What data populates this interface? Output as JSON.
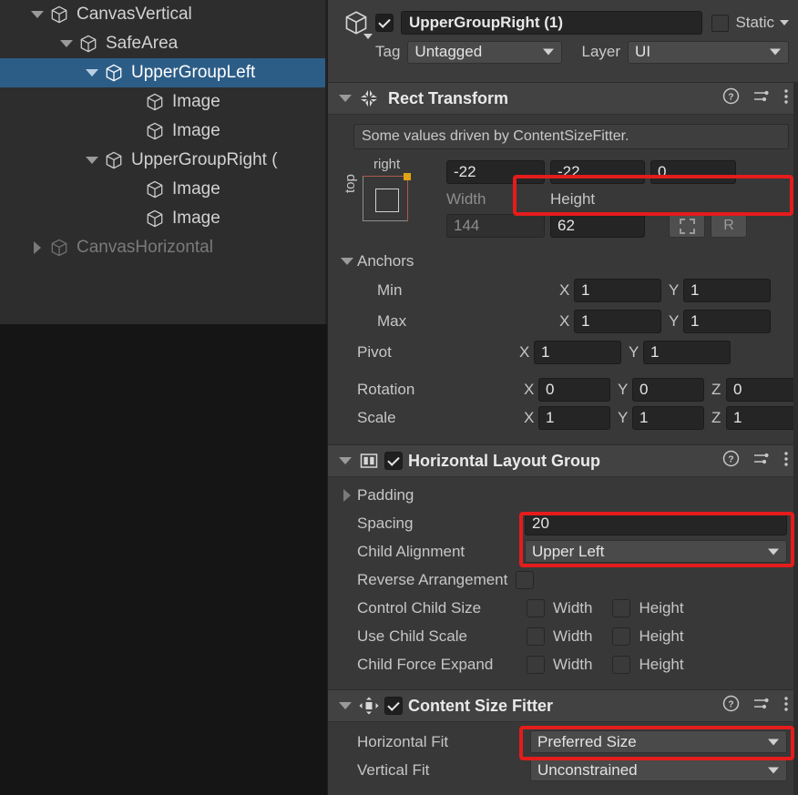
{
  "hierarchy": {
    "rows": [
      {
        "label": "CanvasVertical",
        "indent": 30,
        "arrow": "down",
        "selected": false,
        "dim": false
      },
      {
        "label": "SafeArea",
        "indent": 62,
        "arrow": "down",
        "selected": false,
        "dim": false
      },
      {
        "label": "UpperGroupLeft",
        "indent": 90,
        "arrow": "down",
        "selected": true,
        "dim": false
      },
      {
        "label": "Image",
        "indent": 135,
        "arrow": "none",
        "selected": false,
        "dim": false
      },
      {
        "label": "Image",
        "indent": 135,
        "arrow": "none",
        "selected": false,
        "dim": false
      },
      {
        "label": "UpperGroupRight (",
        "indent": 90,
        "arrow": "down",
        "selected": false,
        "dim": false
      },
      {
        "label": "Image",
        "indent": 135,
        "arrow": "none",
        "selected": false,
        "dim": false
      },
      {
        "label": "Image",
        "indent": 135,
        "arrow": "none",
        "selected": false,
        "dim": false
      },
      {
        "label": "CanvasHorizontal",
        "indent": 30,
        "arrow": "right",
        "selected": false,
        "dim": true
      }
    ]
  },
  "inspector": {
    "header": {
      "enabled_checkbox": true,
      "object_name": "UpperGroupRight (1)",
      "static_label": "Static",
      "static_checked": false,
      "tag_label": "Tag",
      "tag_value": "Untagged",
      "layer_label": "Layer",
      "layer_value": "UI"
    },
    "rect_transform": {
      "title": "Rect Transform",
      "info_text": "Some values driven by ContentSizeFitter.",
      "anchor_preset": {
        "right_label": "right",
        "top_label": "top"
      },
      "offsets": {
        "values": [
          "-22",
          "-22",
          "0"
        ],
        "highlighted": true
      },
      "size": {
        "width_label": "Width",
        "height_label": "Height",
        "width_value": "144",
        "width_driven": true,
        "height_value": "62",
        "height_driven": false,
        "blueprint_button": "blueprint-icon",
        "raw_button": "R"
      },
      "anchors_label": "Anchors",
      "anchors": [
        {
          "label": "Min",
          "x": "1",
          "y": "1"
        },
        {
          "label": "Max",
          "x": "1",
          "y": "1"
        },
        {
          "label": "Pivot",
          "x": "1",
          "y": "1"
        }
      ],
      "transform_rows": [
        {
          "label": "Rotation",
          "x": "0",
          "y": "0",
          "z": "0"
        },
        {
          "label": "Scale",
          "x": "1",
          "y": "1",
          "z": "1"
        }
      ]
    },
    "horizontal_layout_group": {
      "title": "Horizontal Layout Group",
      "enabled": true,
      "padding_label": "Padding",
      "spacing_label": "Spacing",
      "spacing_value": "20",
      "child_alignment_label": "Child Alignment",
      "child_alignment_value": "Upper Left",
      "reverse_arrangement_label": "Reverse Arrangement",
      "reverse_arrangement_checked": false,
      "toggle_rows": [
        {
          "label": "Control Child Size",
          "width_label": "Width",
          "width_checked": false,
          "height_label": "Height",
          "height_checked": false
        },
        {
          "label": "Use Child Scale",
          "width_label": "Width",
          "width_checked": false,
          "height_label": "Height",
          "height_checked": false
        },
        {
          "label": "Child Force Expand",
          "width_label": "Width",
          "width_checked": false,
          "height_label": "Height",
          "height_checked": false
        }
      ]
    },
    "content_size_fitter": {
      "title": "Content Size Fitter",
      "enabled": true,
      "horizontal_fit_label": "Horizontal Fit",
      "horizontal_fit_value": "Preferred Size",
      "vertical_fit_label": "Vertical Fit",
      "vertical_fit_value": "Unconstrained"
    },
    "icons": {
      "help": "help-icon",
      "preset": "preset-icon",
      "menu": "kebab-menu-icon"
    }
  },
  "colors": {
    "highlight_red": "#e41c1c",
    "selection_blue": "#2c5d87",
    "panel_bg": "#383838",
    "hierarchy_bg": "#2d2d2d",
    "anchor_dot": "#e0a416"
  }
}
